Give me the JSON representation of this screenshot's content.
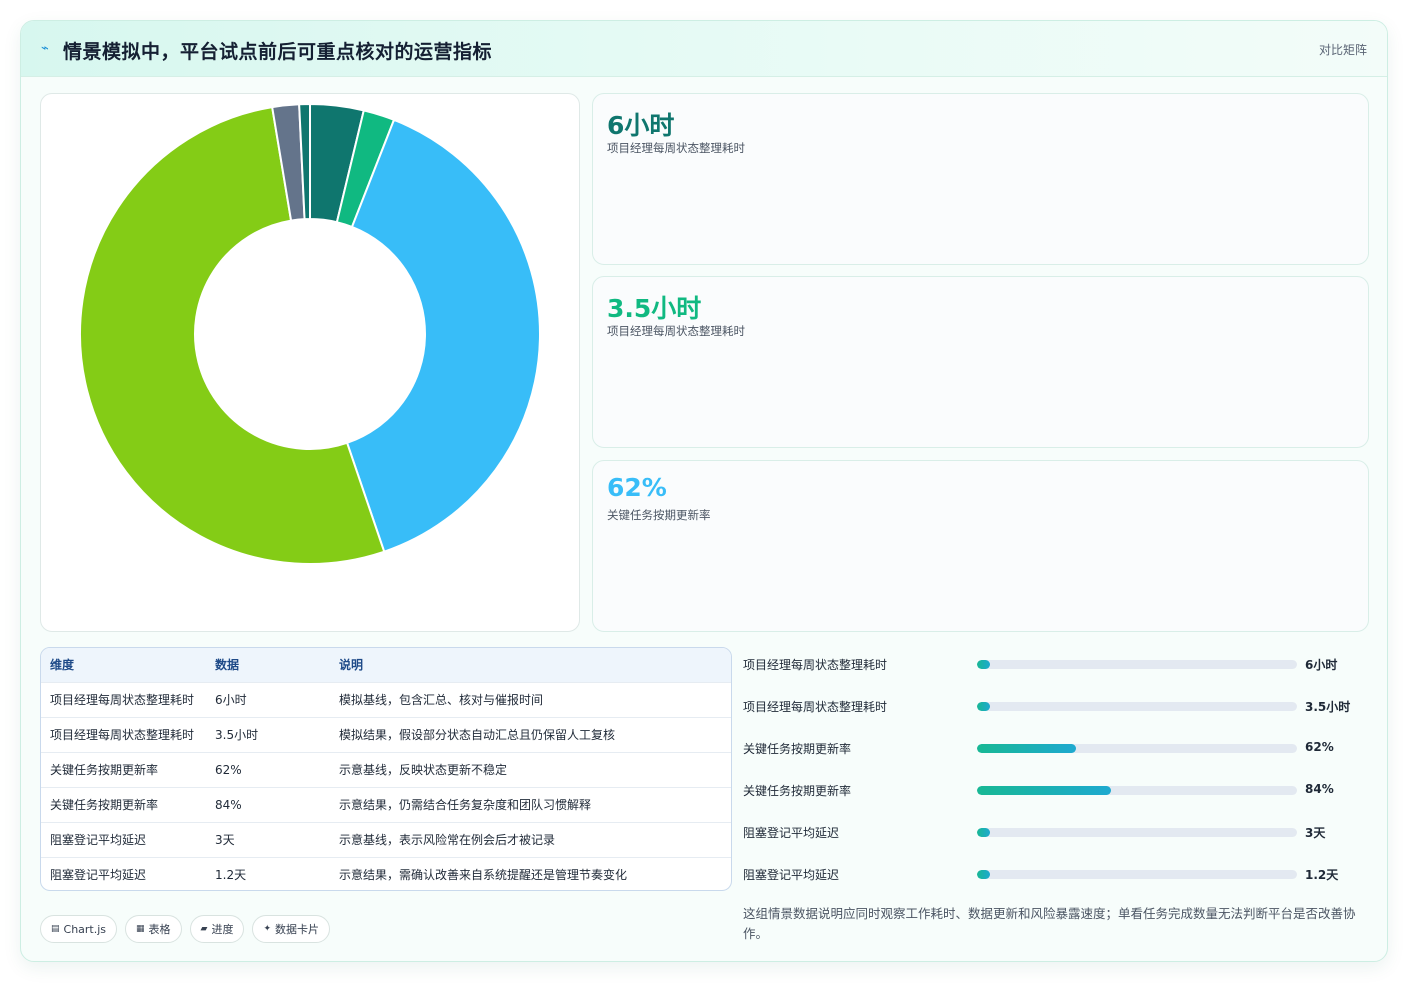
{
  "header": {
    "icon": "pulse-icon",
    "title": "情景模拟中，平台试点前后可重点核对的运营指标",
    "link": "对比矩阵"
  },
  "colors": {
    "teal_dark": "#0f766e",
    "green": "#10b981",
    "sky": "#38bdf8",
    "lime": "#84cc16",
    "slate": "#64748b",
    "accent": "#18b894"
  },
  "chart_data": {
    "type": "doughnut",
    "labels": [
      "项目经理每周状态整理耗时",
      "项目经理每周状态整理耗时",
      "关键任务按期更新率",
      "关键任务按期更新率",
      "阻塞登记平均延迟",
      "阻塞登记平均延迟"
    ],
    "values": [
      6,
      3.5,
      62,
      84,
      3,
      1.2
    ],
    "colors": [
      "#0f766e",
      "#10b981",
      "#38bdf8",
      "#84cc16",
      "#64748b",
      "#0f766e"
    ],
    "legend": "bottom"
  },
  "kpis": [
    {
      "value": "6小时",
      "label": "项目经理每周状态整理耗时",
      "color": "#0f766e"
    },
    {
      "value": "3.5小时",
      "label": "项目经理每周状态整理耗时",
      "color": "#10b981"
    },
    {
      "value": "62%",
      "label": "关键任务按期更新率",
      "color": "#38bdf8"
    }
  ],
  "table": {
    "headers": [
      "维度",
      "数据",
      "说明"
    ],
    "rows": [
      [
        "项目经理每周状态整理耗时",
        "6小时",
        "模拟基线，包含汇总、核对与催报时间"
      ],
      [
        "项目经理每周状态整理耗时",
        "3.5小时",
        "模拟结果，假设部分状态自动汇总且仍保留人工复核"
      ],
      [
        "关键任务按期更新率",
        "62%",
        "示意基线，反映状态更新不稳定"
      ],
      [
        "关键任务按期更新率",
        "84%",
        "示意结果，仍需结合任务复杂度和团队习惯解释"
      ],
      [
        "阻塞登记平均延迟",
        "3天",
        "示意基线，表示风险常在例会后才被记录"
      ],
      [
        "阻塞登记平均延迟",
        "1.2天",
        "示意结果，需确认改善来自系统提醒还是管理节奏变化"
      ]
    ]
  },
  "progress": [
    {
      "label": "项目经理每周状态整理耗时",
      "value": "6小时",
      "fraction": 0.04
    },
    {
      "label": "项目经理每周状态整理耗时",
      "value": "3.5小时",
      "fraction": 0.04
    },
    {
      "label": "关键任务按期更新率",
      "value": "62%",
      "fraction": 0.31
    },
    {
      "label": "关键任务按期更新率",
      "value": "84%",
      "fraction": 0.42
    },
    {
      "label": "阻塞登记平均延迟",
      "value": "3天",
      "fraction": 0.04
    },
    {
      "label": "阻塞登记平均延迟",
      "value": "1.2天",
      "fraction": 0.04
    }
  ],
  "note": "这组情景数据说明应同时观察工作耗时、数据更新和风险暴露速度；单看任务完成数量无法判断平台是否改善协作。",
  "chips": [
    {
      "icon": "chart-icon",
      "glyph": "▤",
      "label": "Chart.js"
    },
    {
      "icon": "table-icon",
      "glyph": "▦",
      "label": "表格"
    },
    {
      "icon": "progress-icon",
      "glyph": "▰",
      "label": "进度"
    },
    {
      "icon": "card-icon",
      "glyph": "✦",
      "label": "数据卡片"
    }
  ]
}
